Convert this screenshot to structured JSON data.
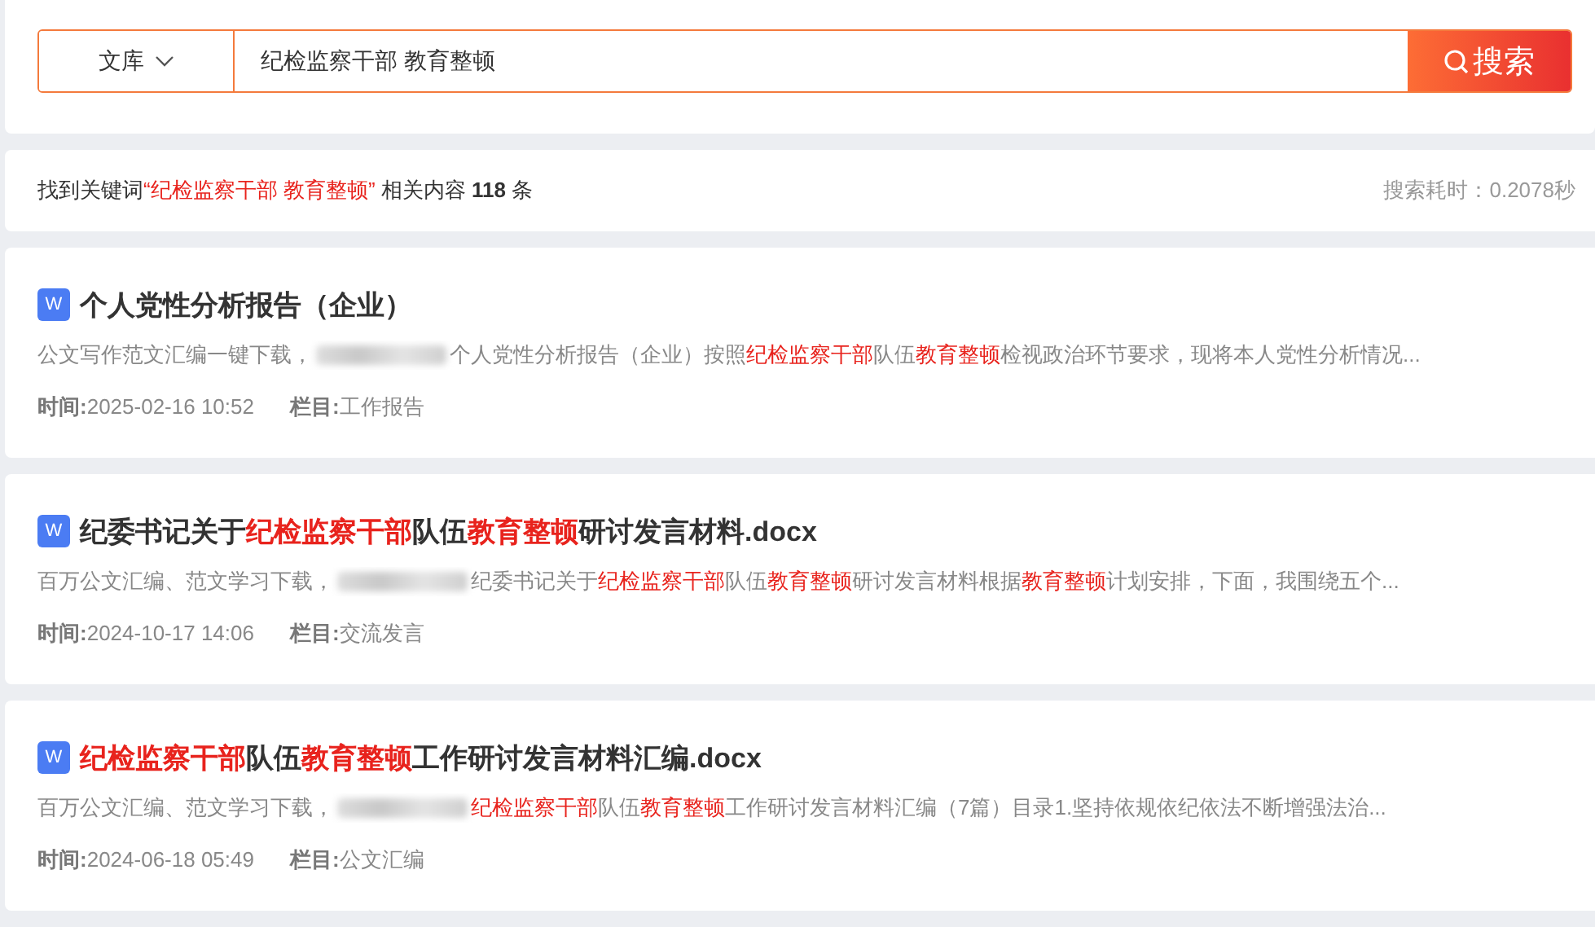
{
  "search": {
    "scope": "文库",
    "query": "纪检监察干部 教育整顿",
    "button": "搜索"
  },
  "summary": {
    "prefix": "找到关键词",
    "keyword": "“纪检监察干部 教育整顿”",
    "middle": "相关内容",
    "count": "118",
    "suffix": "条",
    "time": "搜索耗时：0.2078秒"
  },
  "results": [
    {
      "icon": "W",
      "title": [
        {
          "text": "个人党性分析报告（企业）",
          "highlight": false
        }
      ],
      "snippet_lead": "公文写作范文汇编一键下载，",
      "snippet": [
        {
          "text": "个人党性分析报告（企业）按照",
          "highlight": false
        },
        {
          "text": "纪检监察干部",
          "highlight": true
        },
        {
          "text": "队伍",
          "highlight": false
        },
        {
          "text": "教育整顿",
          "highlight": true
        },
        {
          "text": "检视政治环节要求，现将本人党性分析情况...",
          "highlight": false
        }
      ],
      "time_label": "时间:",
      "time": "2025-02-16 10:52",
      "column_label": "栏目:",
      "column": "工作报告"
    },
    {
      "icon": "W",
      "title": [
        {
          "text": "纪委书记关于",
          "highlight": false
        },
        {
          "text": "纪检监察干部",
          "highlight": true
        },
        {
          "text": "队伍",
          "highlight": false
        },
        {
          "text": "教育整顿",
          "highlight": true
        },
        {
          "text": "研讨发言材料.docx",
          "highlight": false
        }
      ],
      "snippet_lead": "百万公文汇编、范文学习下载，",
      "snippet": [
        {
          "text": "纪委书记关于",
          "highlight": false
        },
        {
          "text": "纪检监察干部",
          "highlight": true
        },
        {
          "text": "队伍",
          "highlight": false
        },
        {
          "text": "教育整顿",
          "highlight": true
        },
        {
          "text": "研讨发言材料根据",
          "highlight": false
        },
        {
          "text": "教育整顿",
          "highlight": true
        },
        {
          "text": "计划安排，下面，我围绕五个...",
          "highlight": false
        }
      ],
      "time_label": "时间:",
      "time": "2024-10-17 14:06",
      "column_label": "栏目:",
      "column": "交流发言"
    },
    {
      "icon": "W",
      "title": [
        {
          "text": "纪检监察干部",
          "highlight": true
        },
        {
          "text": "队伍",
          "highlight": false
        },
        {
          "text": "教育整顿",
          "highlight": true
        },
        {
          "text": "工作研讨发言材料汇编.docx",
          "highlight": false
        }
      ],
      "snippet_lead": "百万公文汇编、范文学习下载，",
      "snippet": [
        {
          "text": "纪检监察干部",
          "highlight": true
        },
        {
          "text": "队伍",
          "highlight": false
        },
        {
          "text": "教育整顿",
          "highlight": true
        },
        {
          "text": "工作研讨发言材料汇编（7篇）目录1.坚持依规依纪依法不断增强法治...",
          "highlight": false
        }
      ],
      "time_label": "时间:",
      "time": "2024-06-18 05:49",
      "column_label": "栏目:",
      "column": "公文汇编"
    }
  ]
}
